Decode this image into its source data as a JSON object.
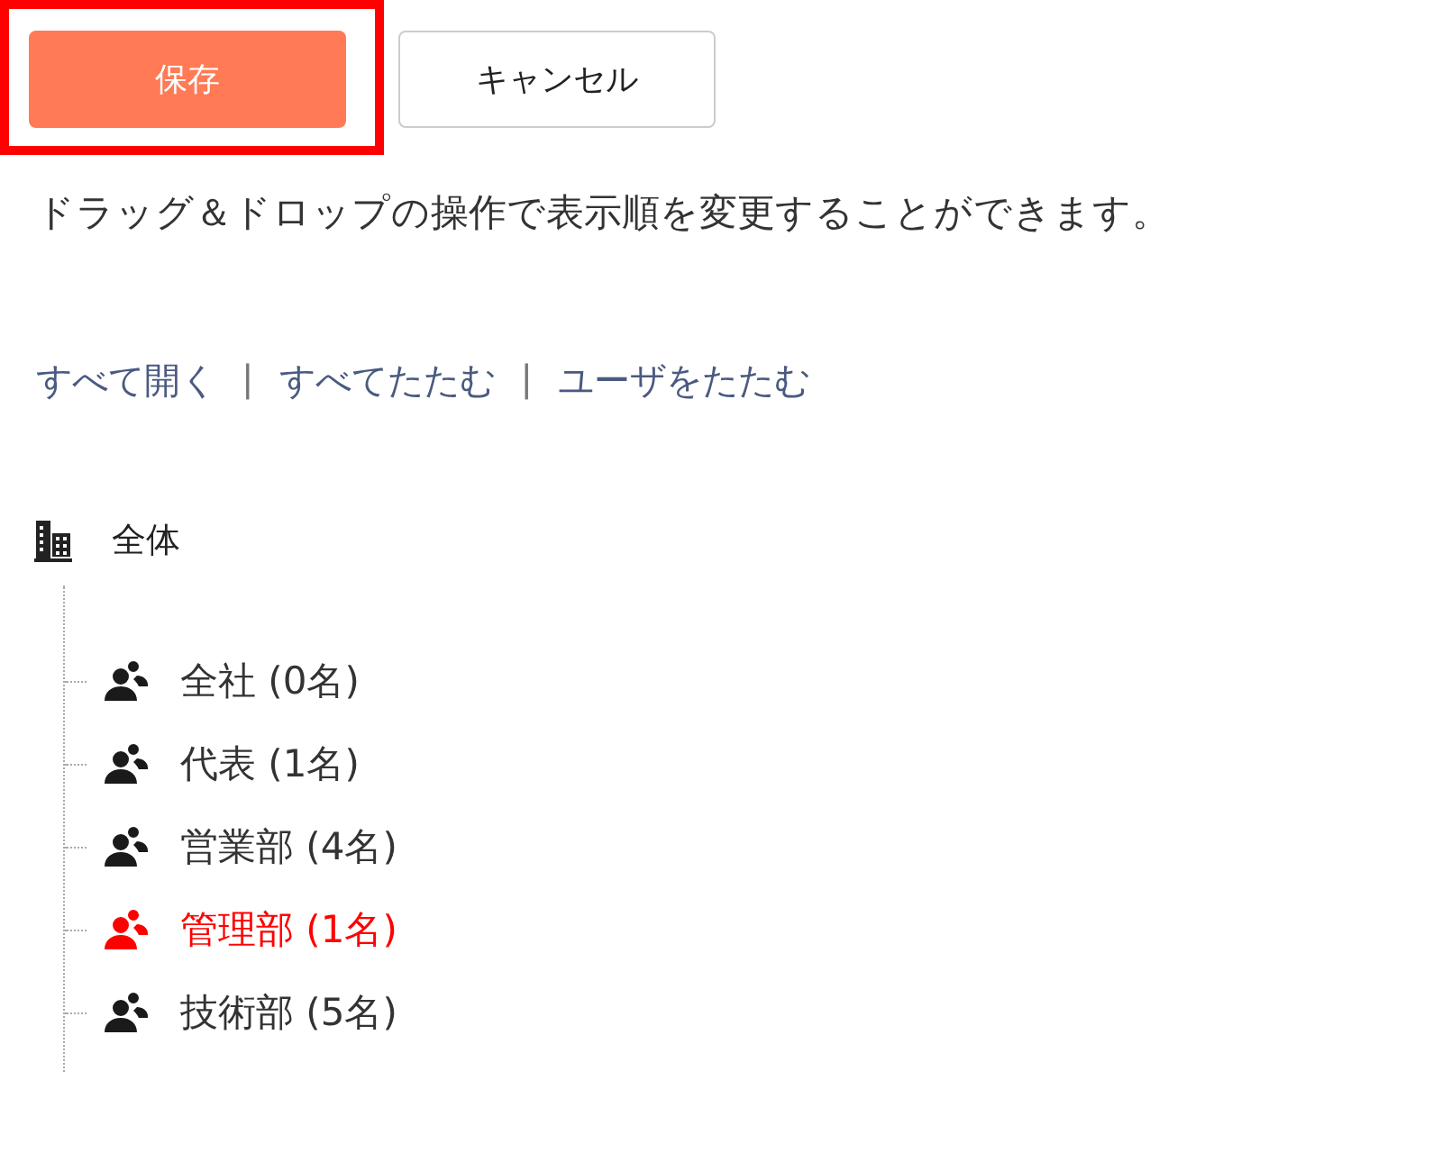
{
  "buttons": [
    {
      "label": "保存",
      "kind": "primary",
      "highlighted": true
    },
    {
      "label": "キャンセル",
      "kind": "secondary",
      "highlighted": false
    }
  ],
  "instruction": "ドラッグ＆ドロップの操作で表示順を変更することができます。",
  "links": [
    {
      "kind": "link",
      "text": "すべて開く"
    },
    {
      "kind": "separator",
      "text": "|"
    },
    {
      "kind": "link",
      "text": "すべてたたむ"
    },
    {
      "kind": "separator",
      "text": "|"
    },
    {
      "kind": "link",
      "text": "ユーザをたたむ"
    }
  ],
  "tree": {
    "label": "全体",
    "children": [
      {
        "label": "全社 (0名)",
        "selected": false
      },
      {
        "label": "代表 (1名)",
        "selected": false
      },
      {
        "label": "営業部 (4名)",
        "selected": false
      },
      {
        "label": "管理部 (1名)",
        "selected": true
      },
      {
        "label": "技術部 (5名)",
        "selected": false
      }
    ]
  }
}
